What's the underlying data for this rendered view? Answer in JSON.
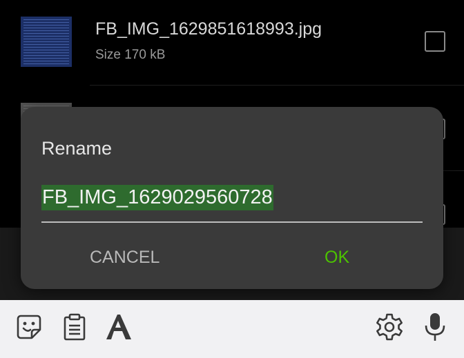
{
  "file_list": {
    "items": [
      {
        "name": "FB_IMG_1629851618993.jpg",
        "size": "Size 170 kB"
      },
      {
        "name": "",
        "size": ""
      },
      {
        "name": "",
        "size": ""
      }
    ]
  },
  "dialog": {
    "title": "Rename",
    "input_value": "FB_IMG_1629029560728",
    "cancel_label": "CANCEL",
    "ok_label": "OK"
  },
  "colors": {
    "dialog_bg": "#3a3a3a",
    "ok_accent": "#4cc300",
    "selection": "#2e6b2e",
    "keyboard_bar": "#f1f1f3"
  },
  "keyboard_toolbar": {
    "icons": [
      "emoji-sticker-icon",
      "clipboard-icon",
      "text-style-icon",
      "settings-gear-icon",
      "microphone-icon"
    ]
  }
}
